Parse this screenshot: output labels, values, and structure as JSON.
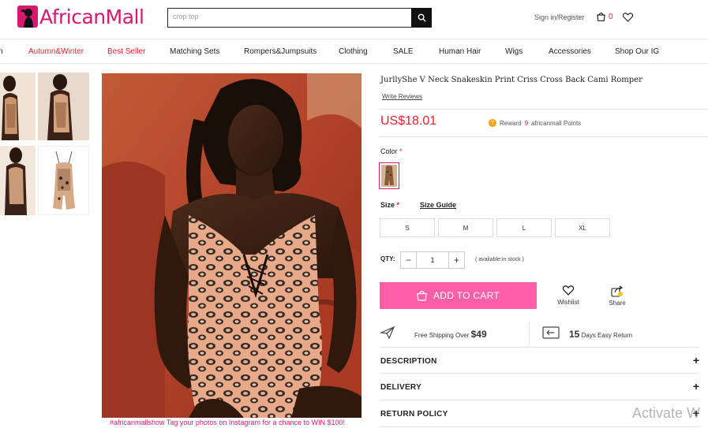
{
  "header": {
    "logo_text": "AfricanMall",
    "search_placeholder": "crop top",
    "signin_label": "Sign in/Register",
    "cart_count": "0"
  },
  "nav": {
    "items": [
      {
        "label": "n",
        "color": "#222222"
      },
      {
        "label": "Autumn&Winter",
        "color": "#e8202b"
      },
      {
        "label": "Best Seller",
        "color": "#e8202b"
      },
      {
        "label": "Matching Sets",
        "color": "#222222"
      },
      {
        "label": "Rompers&Jumpsuits",
        "color": "#222222"
      },
      {
        "label": "Clothing",
        "color": "#222222"
      },
      {
        "label": "SALE",
        "color": "#222222"
      },
      {
        "label": "Human Hair",
        "color": "#222222"
      },
      {
        "label": "Wigs",
        "color": "#222222"
      },
      {
        "label": "Accessories",
        "color": "#222222"
      },
      {
        "label": "Shop Our IG",
        "color": "#222222"
      }
    ]
  },
  "gallery": {
    "caption": "#africanmallshow Tag your photos on Instagram for a chance to WIN $100!"
  },
  "product": {
    "title": "JurllyShe V Neck Snakeskin Print Criss Cross Back Cami Romper",
    "write_reviews": "Write Reviews",
    "price": "US$18.01",
    "reward_label": "Reward",
    "reward_points": "9",
    "reward_suffix": "africanmall Points",
    "color_label": "Color",
    "size_label": "Size",
    "size_guide": "Size Guide",
    "sizes": [
      "S",
      "M",
      "L",
      "XL"
    ],
    "qty_label": "QTY:",
    "qty_value": "1",
    "stock_text": "( avaliable:in stock )",
    "add_to_cart": "ADD TO CART",
    "wishlist": "Wishlist",
    "share": "Share"
  },
  "services": {
    "shipping_text": "Free Shipping Over",
    "shipping_amount": "$49",
    "return_days": "15",
    "return_text": "Days Easy Return"
  },
  "accordion": [
    {
      "title": "DESCRIPTION"
    },
    {
      "title": "DELIVERY"
    },
    {
      "title": "RETURN POLICY"
    }
  ],
  "watermark": "Activate W",
  "colors": {
    "brand_pink": "#d6186f",
    "cart_button": "#fb5fa7",
    "price_red": "#e8202b"
  }
}
